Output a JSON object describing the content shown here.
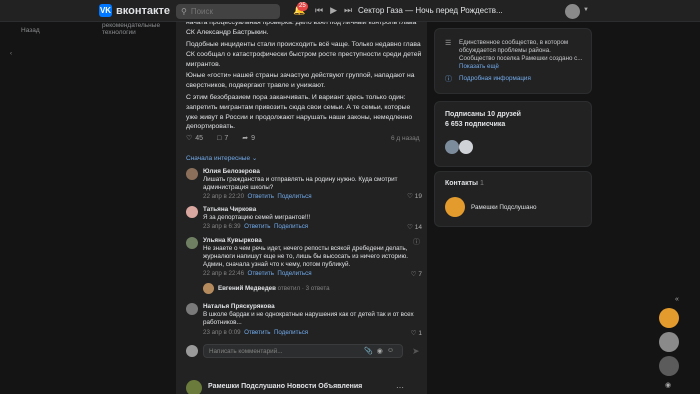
{
  "header": {
    "logo_text": "вконтакте",
    "search_placeholder": "Поиск",
    "notifications_count": "25",
    "now_playing": "Сектор Газа — Ночь перед Рождеств..."
  },
  "left_nav": {
    "recommended": "рекомендательные технологии",
    "back": "Назад"
  },
  "post": {
    "paragraphs": [
      "начата процессуальная проверка. Дело взял под личный контроль глава СК Александр Бастрыкин.",
      "Подобные инциденты стали происходить всё чаще. Только недавно глава СК сообщал о катастрофически быстром росте преступности среди детей мигрантов.",
      "Юные «гости» нашей страны зачастую действуют группой, нападают на сверстников, подвергают травле и унижают.",
      "С этим безобразием пора заканчивать. И вариант здесь только один: запретить мигрантам привозить сюда свои семьи. А те семьи, которые уже живут в России и продолжают нарушать наши законы, немедленно депортировать."
    ],
    "likes": "45",
    "comments": "7",
    "shares": "9",
    "date": "6 д назад",
    "sort_label": "Сначала интересные"
  },
  "comments": [
    {
      "name": "Юлия Белозерова",
      "text": "Лишать гражданства и отправлять на родину нужно. Куда смотрит администрация школы?",
      "date": "22 апр в 22:20",
      "reply": "Ответить",
      "share": "Поделиться",
      "likes": "19"
    },
    {
      "name": "Татьяна Чиркова",
      "text": "Я за депортацию семей мигрантов!!!",
      "date": "23 апр в 6:39",
      "reply": "Ответить",
      "share": "Поделиться",
      "likes": "14"
    },
    {
      "name": "Ульяна Кувыркова",
      "text": "Не знаете о чем речь идет, нечего репосты всякой дребедени делать, журналюги напишут еще не то, лишь бы высосать из ничего историю. Админ, сначала узнай что к чему, потом публикуй.",
      "date": "22 апр в 22:46",
      "reply": "Ответить",
      "share": "Поделиться",
      "likes": "7",
      "reply_author": "Евгений Медведев",
      "reply_verb": "ответил",
      "reply_count": "3 ответа"
    },
    {
      "name": "Наталья Пряскурякова",
      "text": "В школе бардак и не однократные нарушения как от детей так и от всех работников...",
      "date": "23 апр в 0:09",
      "reply": "Ответить",
      "share": "Поделиться",
      "likes": "1"
    }
  ],
  "composer": {
    "placeholder": "Написать комментарий..."
  },
  "next_post": {
    "title": "Рамешки Подслушано Новости Объявления"
  },
  "sidebar": {
    "info_text": "Единственное сообщество, в котором обсуждается проблемы района. Сообщество поселка Рамешки создано с...",
    "show_more": "Показать ещё",
    "details_link": "Подробная информация",
    "subscribers_title": "Подписаны 10 друзей",
    "subscribers_count": "6 653 подписчика",
    "contacts_title": "Контакты",
    "contacts_count": "1",
    "contact_name": "Рамешки Подслушано"
  },
  "colors": {
    "accent": "#71aaeb",
    "brand": "#0077ff",
    "badge": "#e64646"
  }
}
